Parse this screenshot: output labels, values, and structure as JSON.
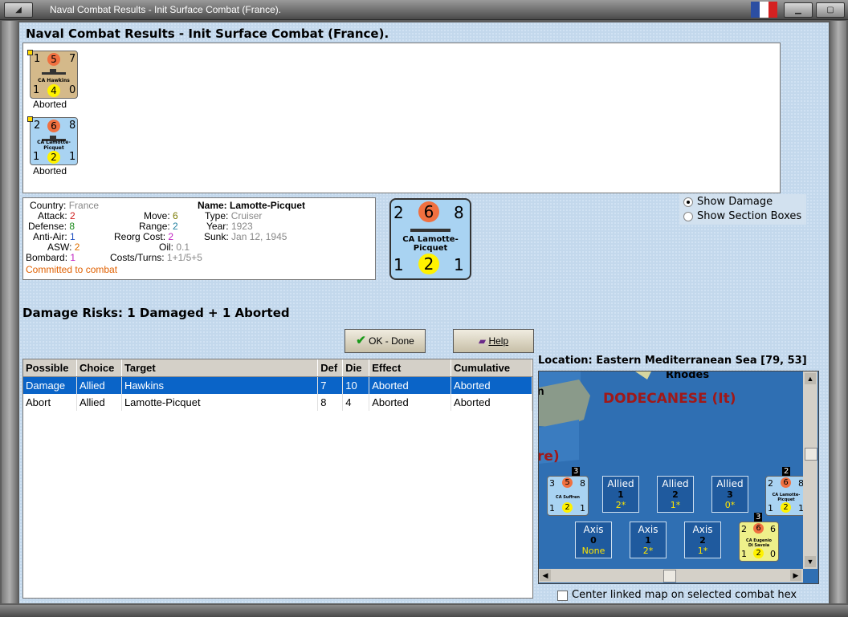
{
  "window": {
    "title": "Naval Combat Results - Init Surface Combat (France).",
    "flag_colors": [
      "#2b4ea2",
      "#ffffff",
      "#d42121"
    ]
  },
  "heading": "Naval Combat Results - Init Surface Combat (France).",
  "units": [
    {
      "name": "CA Hawkins",
      "top_left": "1",
      "top_mid": "5",
      "top_right": "7",
      "bot_left": "1",
      "bot_mid": "4",
      "bot_right": "0",
      "status": "Aborted",
      "color": "#d4b98a"
    },
    {
      "name": "CA Lamotte-Picquet",
      "top_left": "2",
      "top_mid": "6",
      "top_right": "8",
      "bot_left": "1",
      "bot_mid": "2",
      "bot_right": "1",
      "status": "Aborted",
      "color": "#a9d3f2"
    }
  ],
  "info": {
    "country_label": "Country:",
    "country": "France",
    "attack_label": "Attack:",
    "attack": "2",
    "defense_label": "Defense:",
    "defense": "8",
    "antiair_label": "Anti-Air:",
    "antiair": "1",
    "asw_label": "ASW:",
    "asw": "2",
    "bombard_label": "Bombard:",
    "bombard": "1",
    "move_label": "Move:",
    "move": "6",
    "range_label": "Range:",
    "range": "2",
    "reorg_label": "Reorg Cost:",
    "reorg": "2",
    "oil_label": "Oil:",
    "oil": "0.1",
    "costs_label": "Costs/Turns:",
    "costs": "1+1/5+5",
    "name_label": "Name:",
    "name": "Lamotte-Picquet",
    "type_label": "Type:",
    "type": "Cruiser",
    "year_label": "Year:",
    "year": "1923",
    "sunk_label": "Sunk:",
    "sunk": "Jan 12, 1945",
    "status": "Committed to combat"
  },
  "big_counter": {
    "top_left": "2",
    "top_mid": "6",
    "top_right": "8",
    "name_line1": "CA Lamotte-",
    "name_line2": "Picquet",
    "bot_left": "1",
    "bot_mid": "2",
    "bot_right": "1"
  },
  "options": {
    "show_damage": "Show Damage",
    "show_section": "Show Section Boxes"
  },
  "damage_risks": "Damage Risks:  1 Damaged + 1 Aborted",
  "buttons": {
    "ok": "OK - Done",
    "help": "Help"
  },
  "table": {
    "headers": [
      "Possible",
      "Choice",
      "Target",
      "Def",
      "Die",
      "Effect",
      "Cumulative"
    ],
    "rows": [
      [
        "Damage",
        "Allied",
        "Hawkins",
        "7",
        "10",
        "Aborted",
        "Aborted"
      ],
      [
        "Abort",
        "Allied",
        "Lamotte-Picquet",
        "8",
        "4",
        "Aborted",
        "Aborted"
      ]
    ]
  },
  "location": "Location:  Eastern Mediterranean Sea [79, 53]",
  "map": {
    "region_label": "DODECANESE (It)",
    "town": "Rhodes",
    "partial_n": "n",
    "partial_re": "re)",
    "allied_slots": [
      {
        "label": "Allied",
        "num": "1",
        "val": "2*"
      },
      {
        "label": "Allied",
        "num": "2",
        "val": "1*"
      },
      {
        "label": "Allied",
        "num": "3",
        "val": "0*"
      }
    ],
    "axis_slots": [
      {
        "label": "Axis",
        "num": "0",
        "val": "None"
      },
      {
        "label": "Axis",
        "num": "1",
        "val": "2*"
      },
      {
        "label": "Axis",
        "num": "2",
        "val": "1*"
      }
    ],
    "suffren": {
      "stack": "3",
      "tl": "3",
      "tm": "5",
      "tr": "8",
      "bl": "1",
      "bm": "2",
      "br": "1",
      "name": "CA Suffren"
    },
    "lamotte": {
      "stack": "2",
      "tl": "2",
      "tm": "6",
      "tr": "8",
      "bl": "1",
      "bm": "2",
      "br": "1",
      "name1": "CA Lamotte-",
      "name2": "Picquet"
    },
    "eugenio": {
      "stack": "3",
      "tl": "2",
      "tm": "6",
      "tr": "6",
      "bl": "1",
      "bm": "2",
      "br": "0",
      "name1": "CA Eugenio",
      "name2": "Di Savoia"
    }
  },
  "center_checkbox": "Center linked map on selected combat hex"
}
